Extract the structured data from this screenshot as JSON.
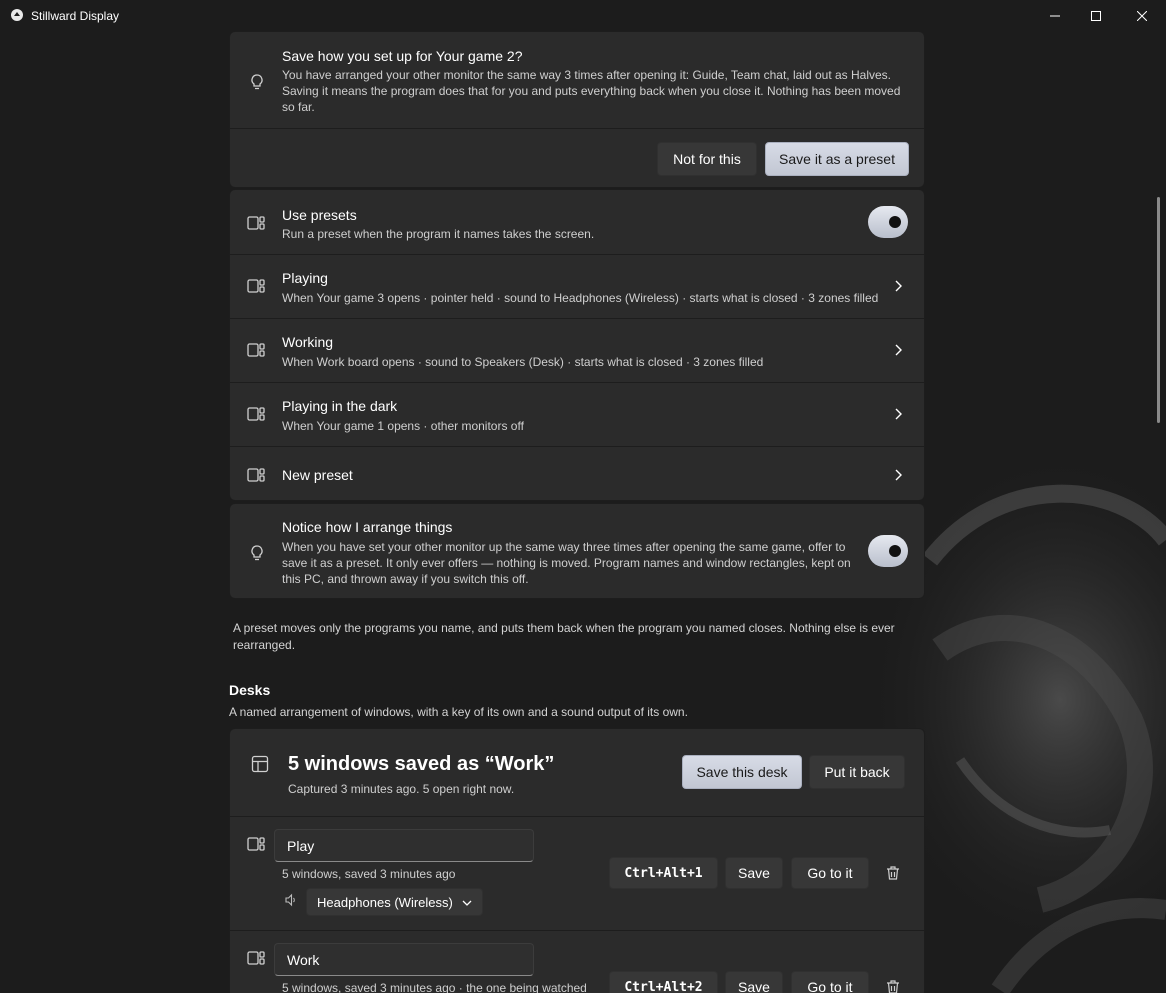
{
  "window": {
    "title": "Stillward Display"
  },
  "suggestion": {
    "title": "Save how you set up for Your game 2?",
    "description": "You have arranged your other monitor the same way 3 times after opening it: Guide, Team chat, laid out as Halves. Saving it means the program does that for you and puts everything back when you close it. Nothing has been moved so far.",
    "decline_label": "Not for this",
    "accept_label": "Save it as a preset"
  },
  "presets": {
    "use_presets": {
      "title": "Use presets",
      "description": "Run a preset when the program it names takes the screen.",
      "enabled": true
    },
    "items": [
      {
        "title": "Playing",
        "description": "When Your game 3 opens · pointer held · sound to Headphones (Wireless) · starts what is closed · 3 zones filled"
      },
      {
        "title": "Working",
        "description": "When Work board opens · sound to Speakers (Desk) · starts what is closed · 3 zones filled"
      },
      {
        "title": "Playing in the dark",
        "description": "When Your game 1 opens · other monitors off"
      }
    ],
    "new_preset_label": "New preset"
  },
  "notice": {
    "title": "Notice how I arrange things",
    "description": "When you have set your other monitor up the same way three times after opening the same game, offer to save it as a preset. It only ever offers — nothing is moved. Program names and window rectangles, kept on this PC, and thrown away if you switch this off.",
    "enabled": true
  },
  "preset_note": "A preset moves only the programs you name, and puts them back when the program you named closes. Nothing else is ever rearranged.",
  "desks": {
    "heading": "Desks",
    "subheading": "A named arrangement of windows, with a key of its own and a sound output of its own.",
    "current": {
      "title": "5 windows saved as “Work”",
      "subtitle": "Captured 3 minutes ago. 5 open right now.",
      "save_label": "Save this desk",
      "restore_label": "Put it back"
    },
    "list": [
      {
        "name": "Play",
        "meta": "5 windows, saved 3 minutes ago",
        "shortcut": "Ctrl+Alt+1",
        "save_label": "Save",
        "go_label": "Go to it",
        "sound_output": "Headphones (Wireless)"
      },
      {
        "name": "Work",
        "meta": "5 windows, saved 3 minutes ago · the one being watched",
        "shortcut": "Ctrl+Alt+2",
        "save_label": "Save",
        "go_label": "Go to it"
      }
    ]
  },
  "colors": {
    "background": "#1c1c1c",
    "card": "#2b2b2b",
    "accent_button": "#c9cdd8"
  }
}
